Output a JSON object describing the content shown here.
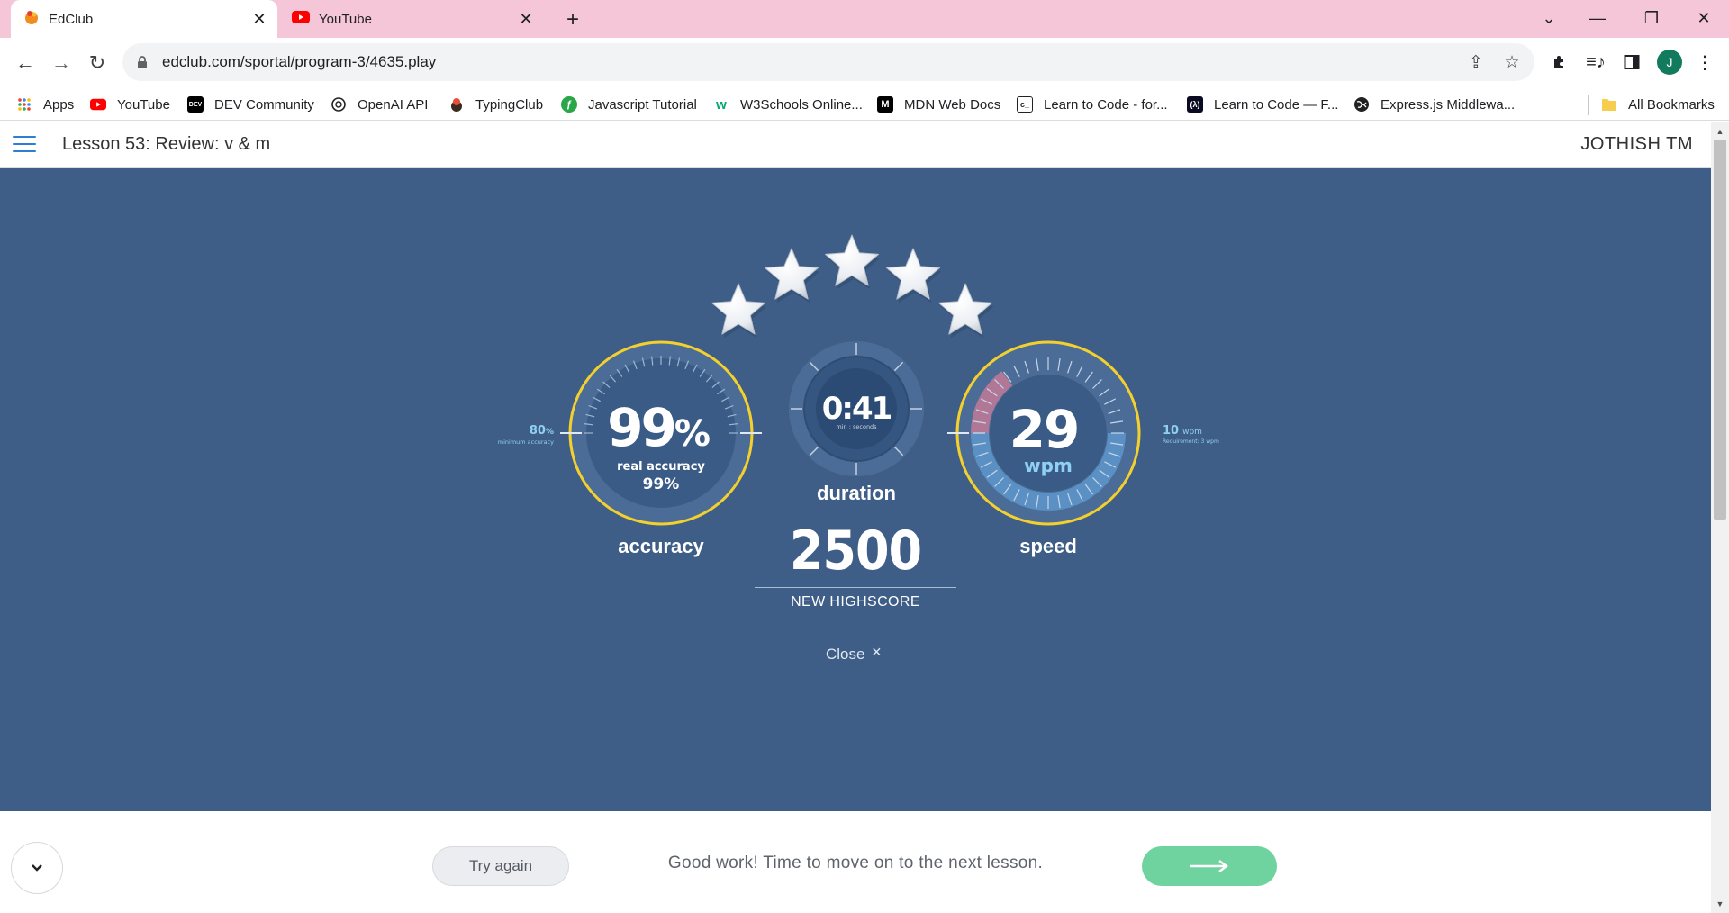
{
  "browser": {
    "tabs": [
      {
        "title": "EdClub",
        "active": true,
        "favicon": "edclub-icon"
      },
      {
        "title": "YouTube",
        "active": false,
        "favicon": "youtube-icon"
      }
    ],
    "url": "edclub.com/sportal/program-3/4635.play",
    "profile_initial": "J",
    "bookmarks": [
      {
        "label": "Apps",
        "icon": "apps-grid-icon"
      },
      {
        "label": "YouTube",
        "icon": "youtube-icon"
      },
      {
        "label": "DEV Community",
        "icon": "dev-icon"
      },
      {
        "label": "OpenAI API",
        "icon": "openai-icon"
      },
      {
        "label": "TypingClub",
        "icon": "typingclub-icon"
      },
      {
        "label": "Javascript Tutorial",
        "icon": "javascript-icon"
      },
      {
        "label": "W3Schools Online...",
        "icon": "w3schools-icon"
      },
      {
        "label": "MDN Web Docs",
        "icon": "mdn-icon"
      },
      {
        "label": "Learn to Code - for...",
        "icon": "freecodecamp-icon"
      },
      {
        "label": "Learn to Code — F...",
        "icon": "freecodecamp-icon"
      },
      {
        "label": "Express.js Middlewa...",
        "icon": "globe-icon"
      }
    ],
    "all_bookmarks_label": "All Bookmarks"
  },
  "header": {
    "lesson_title": "Lesson 53: Review: v & m",
    "user_name": "JOTHISH TM"
  },
  "results": {
    "stars_earned": 5,
    "stars_total": 5,
    "accuracy": {
      "value": "99",
      "unit": "%",
      "real_accuracy_label": "real accuracy",
      "real_accuracy_value": "99%",
      "minimum_value": "80",
      "minimum_unit": "%",
      "minimum_label": "minimum accuracy",
      "label": "accuracy"
    },
    "duration": {
      "value": "0:41",
      "sub_label": "min : seconds",
      "label": "duration"
    },
    "speed": {
      "value": "29",
      "unit": "wpm",
      "requirement_value": "10",
      "requirement_unit": "wpm",
      "requirement_label": "Requirement: 3 wpm",
      "label": "speed"
    },
    "highscore": {
      "value": "2500",
      "label": "NEW HIGHSCORE"
    },
    "close_label": "Close",
    "colors": {
      "stage_bg": "#3e5e87",
      "dial_ring": "#f3d02e",
      "accent_text": "#8fd0f3",
      "next_button": "#6ed39e"
    }
  },
  "footer": {
    "try_again_label": "Try again",
    "message": "Good work! Time to move on to the next lesson."
  }
}
